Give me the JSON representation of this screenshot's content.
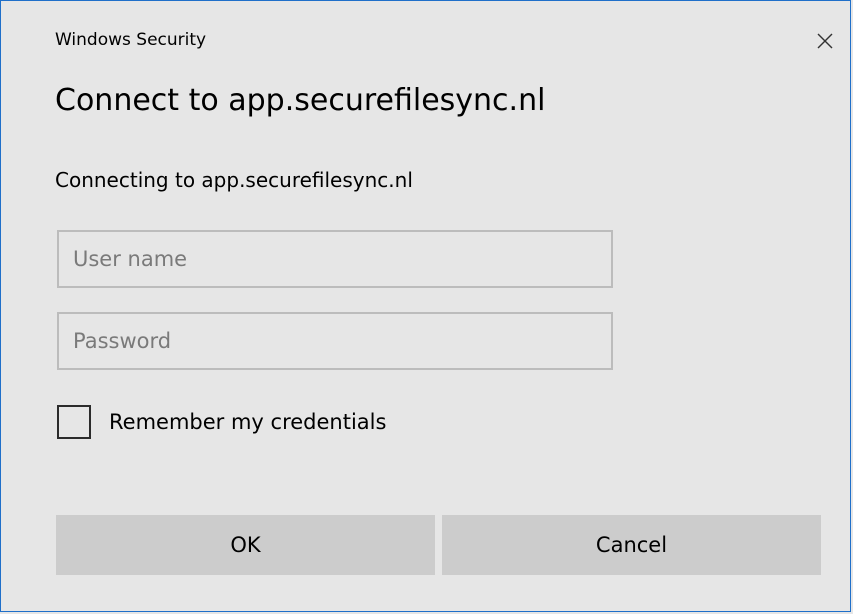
{
  "window": {
    "title": "Windows Security",
    "close_icon": "close-icon",
    "border_color": "#1f6fc9",
    "background_color": "#e6e6e6"
  },
  "dialog": {
    "heading": "Connect to app.securefilesync.nl",
    "subtext": "Connecting to app.securefilesync.nl"
  },
  "form": {
    "username": {
      "value": "",
      "placeholder": "User name"
    },
    "password": {
      "value": "",
      "placeholder": "Password"
    },
    "remember": {
      "label": "Remember my credentials",
      "checked": false
    }
  },
  "buttons": {
    "ok_label": "OK",
    "cancel_label": "Cancel",
    "button_color": "#cccccc"
  }
}
